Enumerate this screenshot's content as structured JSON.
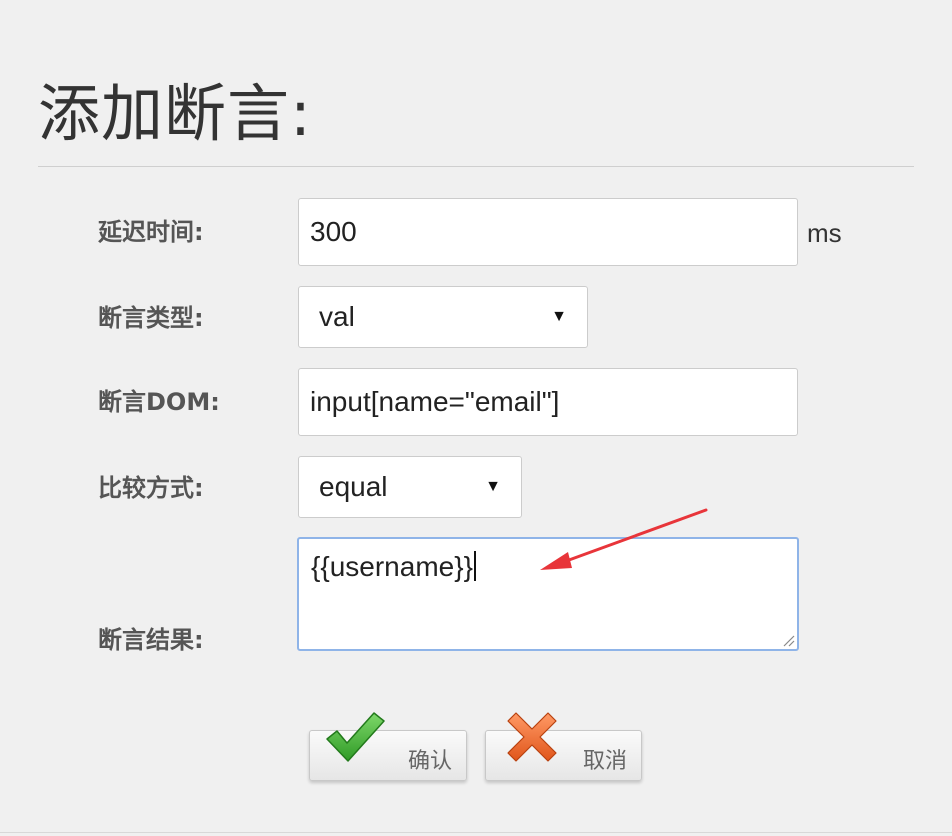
{
  "dialog": {
    "title": "添加断言:"
  },
  "form": {
    "delay": {
      "label": "延迟时间:",
      "value": "300",
      "unit": "ms"
    },
    "assert_type": {
      "label": "断言类型:",
      "selected": "val"
    },
    "assert_dom": {
      "label": "断言DOM:",
      "value": "input[name=\"email\"]"
    },
    "compare": {
      "label": "比较方式:",
      "selected": "equal"
    },
    "result": {
      "label": "断言结果:",
      "value": "{{username}}"
    }
  },
  "buttons": {
    "confirm": "确认",
    "cancel": "取消"
  },
  "icons": {
    "confirm": "checkmark-icon",
    "cancel": "cross-icon",
    "annotation": "red-arrow"
  },
  "colors": {
    "background": "#f0f0f0",
    "focus_border": "#8fb4e8",
    "check_green": "#3aa52f",
    "cross_orange": "#f06a2a",
    "arrow_red": "#e8353a"
  }
}
